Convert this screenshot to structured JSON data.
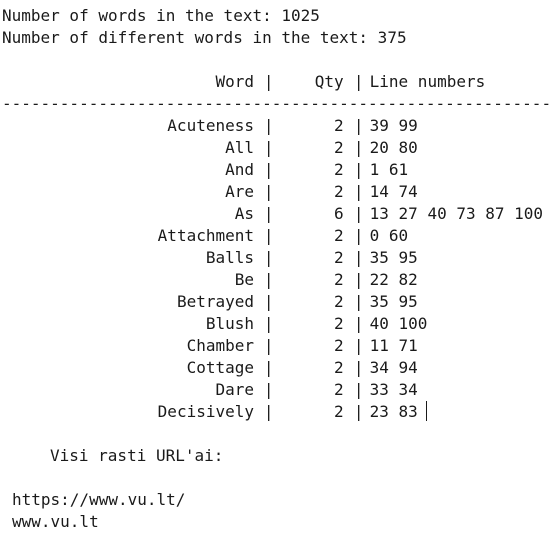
{
  "summary": {
    "word_count_line": "Number of words in the text: 1025",
    "distinct_count_line": "Number of different words in the text: 375"
  },
  "table": {
    "headers": {
      "word": "Word",
      "qty": "Qty",
      "lines": "Line numbers"
    },
    "separator_char": "-",
    "column_divider": "|",
    "rows": [
      {
        "word": "Acuteness",
        "qty": "2",
        "lines": "39 99"
      },
      {
        "word": "All",
        "qty": "2",
        "lines": "20 80"
      },
      {
        "word": "And",
        "qty": "2",
        "lines": "1 61"
      },
      {
        "word": "Are",
        "qty": "2",
        "lines": "14 74"
      },
      {
        "word": "As",
        "qty": "6",
        "lines": "13 27 40 73 87 100"
      },
      {
        "word": "Attachment",
        "qty": "2",
        "lines": "0 60"
      },
      {
        "word": "Balls",
        "qty": "2",
        "lines": "35 95"
      },
      {
        "word": "Be",
        "qty": "2",
        "lines": "22 82"
      },
      {
        "word": "Betrayed",
        "qty": "2",
        "lines": "35 95"
      },
      {
        "word": "Blush",
        "qty": "2",
        "lines": "40 100"
      },
      {
        "word": "Chamber",
        "qty": "2",
        "lines": "11 71"
      },
      {
        "word": "Cottage",
        "qty": "2",
        "lines": "34 94"
      },
      {
        "word": "Dare",
        "qty": "2",
        "lines": "33 34"
      },
      {
        "word": "Decisively",
        "qty": "2",
        "lines": "23 83"
      }
    ]
  },
  "urls": {
    "heading": "Visi rasti URL'ai:",
    "items": [
      "https://www.vu.lt/",
      "www.vu.lt"
    ]
  }
}
